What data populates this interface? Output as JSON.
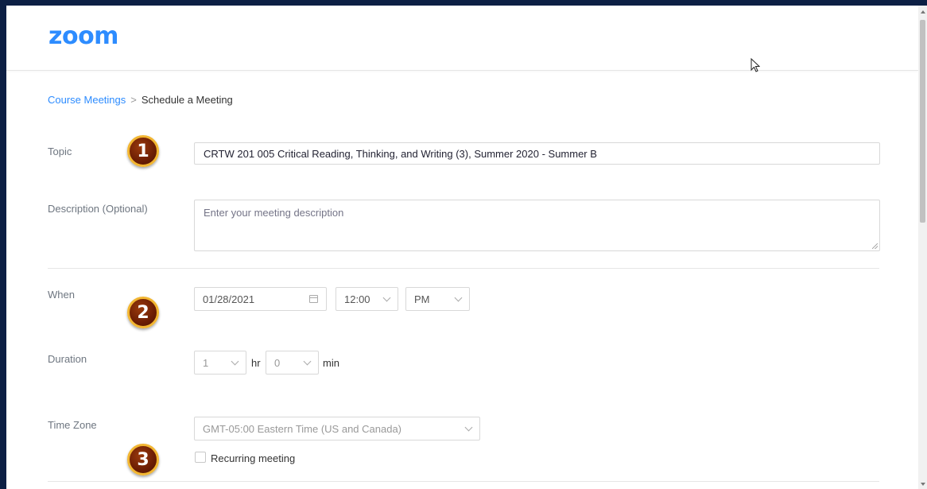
{
  "header": {
    "logo": "zoom"
  },
  "breadcrumb": {
    "parent": "Course Meetings",
    "separator": ">",
    "current": "Schedule a Meeting"
  },
  "form": {
    "topic": {
      "label": "Topic",
      "value": "CRTW 201 005 Critical Reading, Thinking, and Writing (3), Summer 2020 - Summer B"
    },
    "description": {
      "label": "Description (Optional)",
      "placeholder": "Enter your meeting description"
    },
    "when": {
      "label": "When",
      "date": "01/28/2021",
      "time": "12:00",
      "ampm": "PM"
    },
    "duration": {
      "label": "Duration",
      "hours": "1",
      "hr_unit": "hr",
      "minutes": "0",
      "min_unit": "min"
    },
    "timezone": {
      "label": "Time Zone",
      "value": "GMT-05:00 Eastern Time (US and Canada)"
    },
    "recurring": {
      "label": "Recurring meeting",
      "checked": false
    }
  },
  "annotations": [
    "1",
    "2",
    "3"
  ],
  "colors": {
    "brand": "#2d8cff",
    "badge_fill": "#6b1d04",
    "badge_ring": "#f2b632",
    "frame": "#0c1f44"
  }
}
